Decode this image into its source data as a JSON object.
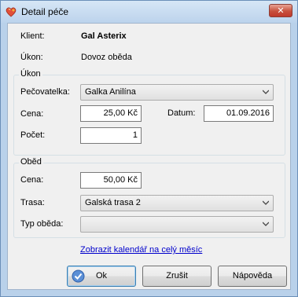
{
  "window": {
    "title": "Detail péče",
    "close_symbol": "✕"
  },
  "header": {
    "client_label": "Klient:",
    "client_value": "Gal Asterix",
    "action_label": "Úkon:",
    "action_value": "Dovoz oběda"
  },
  "ukon_group": {
    "title": "Úkon",
    "caregiver_label": "Pečovatelka:",
    "caregiver_value": "Galka Anilína",
    "price_label": "Cena:",
    "price_value": "25,00 Kč",
    "date_label": "Datum:",
    "date_value": "01.09.2016",
    "count_label": "Počet:",
    "count_value": "1"
  },
  "lunch_group": {
    "title": "Oběd",
    "price_label": "Cena:",
    "price_value": "50,00 Kč",
    "route_label": "Trasa:",
    "route_value": "Galská trasa 2",
    "type_label": "Typ oběda:",
    "type_value": ""
  },
  "calendar_link": "Zobrazit kalendář na celý měsíc",
  "buttons": {
    "ok": "Ok",
    "cancel": "Zrušit",
    "help": "Nápověda"
  },
  "icons": {
    "app": "heart-icon",
    "ok": "checkmark-icon",
    "close": "close-icon",
    "dropdown": "chevron-down-icon"
  }
}
